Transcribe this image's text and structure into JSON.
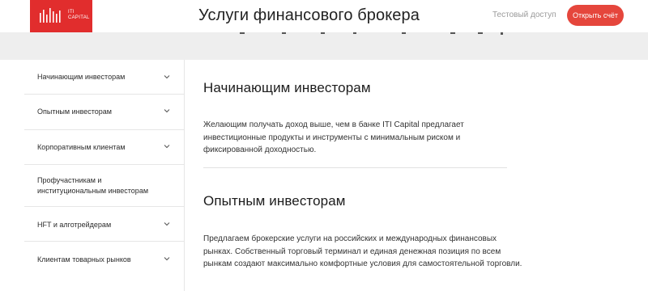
{
  "header": {
    "logo_text_line1": "ITI",
    "logo_text_line2": "CAPITAL",
    "title": "Услуги финансового брокера",
    "demo_link": "Тестовый доступ",
    "open_account": "Открыть счёт"
  },
  "sidebar": {
    "items": [
      {
        "label": "Начинающим инвесторам"
      },
      {
        "label": "Опытным инвесторам"
      },
      {
        "label": "Корпоративным клиентам"
      },
      {
        "label": "Профучастникам и институциональным инвесторам"
      },
      {
        "label": "HFT и алготрейдерам"
      },
      {
        "label": "Клиентам товарных рынков"
      }
    ]
  },
  "main": {
    "sections": [
      {
        "title": "Начинающим инвесторам",
        "text": "Желающим получать доход выше, чем в банке ITI Capital предлагает инвестиционные продукты и инструменты с минимальным риском и фиксированной доходностью."
      },
      {
        "title": "Опытным инвесторам",
        "text": "Предлагаем брокерские услуги на российских и международных финансовых рынках. Собственный торговый терминал и единая денежная позиция по всем рынкам создают максимально комфортные условия для самостоятельной торговли."
      }
    ]
  },
  "colors": {
    "brand_red": "#e12d2d",
    "button_red": "#e5463c",
    "band_grey": "#eeeeee"
  }
}
